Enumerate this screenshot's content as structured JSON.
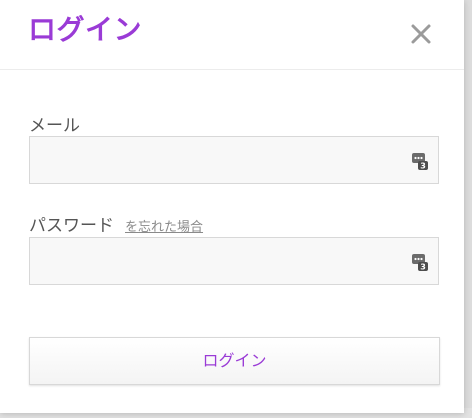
{
  "modal": {
    "title": "ログイン",
    "close_icon": "close-icon",
    "accent_color": "#9a3bd6"
  },
  "form": {
    "email_label": "メール",
    "email_value": "",
    "password_label": "パスワード",
    "forgot_link": "を忘れた場合",
    "password_value": "",
    "field_icon": "password-manager-icon",
    "submit_label": "ログイン"
  }
}
